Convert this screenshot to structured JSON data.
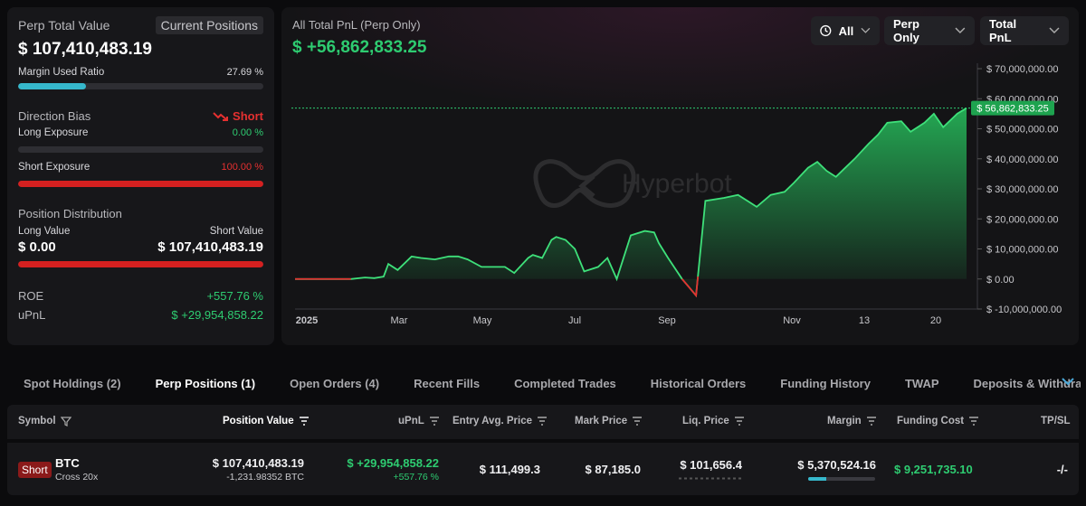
{
  "summary": {
    "perp_total_label": "Perp Total Value",
    "current_positions_label": "Current Positions",
    "perp_total_value": "$ 107,410,483.19",
    "margin_used_label": "Margin Used Ratio",
    "margin_used_value": "27.69 %",
    "margin_used_fraction": 0.2769,
    "direction_bias_label": "Direction Bias",
    "direction_bias_value": "Short",
    "long_exposure_label": "Long Exposure",
    "long_exposure_value": "0.00 %",
    "long_exposure_fraction": 0.0,
    "short_exposure_label": "Short Exposure",
    "short_exposure_value": "100.00 %",
    "short_exposure_fraction": 1.0,
    "position_distribution_label": "Position Distribution",
    "long_value_label": "Long Value",
    "short_value_label": "Short Value",
    "long_value": "$ 0.00",
    "short_value": "$ 107,410,483.19",
    "roe_label": "ROE",
    "roe_value": "+557.76 %",
    "upnl_label": "uPnL",
    "upnl_value": "$ +29,954,858.22"
  },
  "chart_header": {
    "title": "All Total PnL (Perp Only)",
    "total": "$ +56,862,833.25",
    "range_label": "All",
    "scope_label": "Perp Only",
    "metric_label": "Total PnL",
    "watermark": "Hyperbot"
  },
  "chart_data": {
    "type": "area",
    "x_ticks": [
      "2025",
      "Mar",
      "May",
      "Jul",
      "Sep",
      "Nov",
      "13",
      "20"
    ],
    "y_ticks": [
      70000000,
      60000000,
      50000000,
      40000000,
      30000000,
      20000000,
      10000000,
      0,
      -10000000
    ],
    "y_tick_labels": [
      "$ 70,000,000.00",
      "$ 60,000,000.00",
      "$ 50,000,000.00",
      "$ 40,000,000.00",
      "$ 30,000,000.00",
      "$ 20,000,000.00",
      "$ 10,000,000.00",
      "$ 0.00",
      "$ -10,000,000.00"
    ],
    "ylim": [
      -10000000,
      70000000
    ],
    "current_value": 56862833.25,
    "current_label": "$ 56,862,833.25",
    "series": [
      {
        "x": [
          0,
          0.05,
          0.1,
          0.12,
          0.15,
          0.17,
          0.19,
          0.2,
          0.22,
          0.25,
          0.27,
          0.3,
          0.33,
          0.35,
          0.37,
          0.4,
          0.43,
          0.45,
          0.47,
          0.5,
          0.51,
          0.53,
          0.55,
          0.56,
          0.58,
          0.6,
          0.62,
          0.65,
          0.67,
          0.69,
          0.72,
          0.75,
          0.77,
          0.78,
          0.8,
          0.83,
          0.86,
          0.88,
          0.92,
          0.95,
          0.97,
          0.99,
          1.02,
          1.05,
          1.07,
          1.1,
          1.12,
          1.14,
          1.16,
          1.18,
          1.2,
          1.23,
          1.25,
          1.27,
          1.3,
          1.32,
          1.35,
          1.37,
          1.39,
          1.42,
          1.44
        ],
        "y": [
          0,
          0,
          0,
          0,
          500000,
          300000,
          800000,
          5000000,
          3000000,
          7500000,
          7000000,
          6500000,
          7500000,
          7500000,
          6500000,
          4000000,
          4000000,
          4000000,
          2000000,
          7000000,
          8000000,
          7000000,
          13000000,
          14000000,
          13000000,
          10000000,
          2500000,
          4000000,
          7000000,
          0,
          14500000,
          16000000,
          15500000,
          12000000,
          7000000,
          0,
          -5500000,
          26000000,
          27000000,
          28000000,
          26000000,
          24000000,
          28000000,
          29000000,
          32000000,
          37000000,
          39000000,
          36000000,
          34000000,
          37000000,
          40000000,
          45000000,
          48000000,
          52000000,
          52500000,
          49000000,
          52000000,
          55000000,
          50500000,
          55000000,
          56862833.25
        ]
      }
    ],
    "grid": false,
    "legend": "none"
  },
  "tabs": [
    {
      "label": "Spot Holdings (2)"
    },
    {
      "label": "Perp Positions (1)"
    },
    {
      "label": "Open Orders (4)"
    },
    {
      "label": "Recent Fills"
    },
    {
      "label": "Completed Trades"
    },
    {
      "label": "Historical Orders"
    },
    {
      "label": "Funding History"
    },
    {
      "label": "TWAP"
    },
    {
      "label": "Deposits & Withdraw"
    }
  ],
  "table": {
    "headers": [
      "Symbol",
      "Position Value",
      "uPnL",
      "Entry Avg. Price",
      "Mark Price",
      "Liq. Price",
      "Margin",
      "Funding Cost",
      "TP/SL"
    ],
    "row": {
      "side": "Short",
      "symbol": "BTC",
      "leverage": "Cross 20x",
      "position_value": "$ 107,410,483.19",
      "position_size": "-1,231.98352 BTC",
      "upnl": "$ +29,954,858.22",
      "upnl_pct": "+557.76 %",
      "entry_price": "$ 111,499.3",
      "mark_price": "$ 87,185.0",
      "liq_price": "$ 101,656.4",
      "margin": "$ 5,370,524.16",
      "margin_fraction": 0.2769,
      "funding_cost": "$ 9,251,735.10",
      "tpsl": "-/-"
    }
  },
  "colors": {
    "accent_green": "#2ecc71",
    "accent_red": "#e53030",
    "margin_bar": "#36b8cc",
    "panel_bg": "#17171a"
  }
}
